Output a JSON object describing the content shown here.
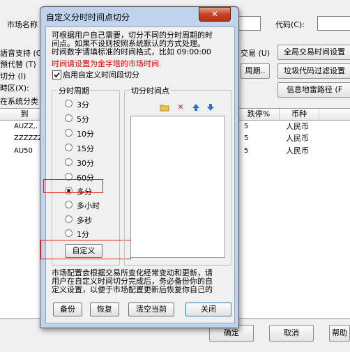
{
  "background": {
    "market_name_label": "市场名称",
    "code_label": "代码(C):",
    "left_labels": [
      "語音支持 (G",
      "預代替 (T)",
      "切分 (I)",
      "時区(X):",
      "在系统分类"
    ],
    "right_labels": [
      "交易 (U)"
    ],
    "right_buttons": [
      "全局交易时间设置",
      "垃圾代码过滤设置",
      "信息地雷路径 (F"
    ],
    "period_button": "周期..",
    "table": {
      "headers": [
        "到",
        "跌停%",
        "币种"
      ],
      "rows": [
        {
          "to": "AUZZ,.",
          "pct": "5",
          "currency": "人民币"
        },
        {
          "to": "ZZZZZZ",
          "pct": "5",
          "currency": "人民币"
        },
        {
          "to": "AU50",
          "pct": "5",
          "currency": "人民币"
        }
      ]
    },
    "bottom_buttons": {
      "ok": "确定",
      "cancel": "取消",
      "help": "帮助"
    }
  },
  "dialog": {
    "title": "自定义分时时间点切分",
    "close_symbol": "✕",
    "intro_line1": "可根据用户自己需要，切分不同的分时周期的时",
    "intro_line2": "间点。如果不设则按照系统默认的方式处理。",
    "intro_line3": "时间数字请填标准的时间格式，比如 09:00:00",
    "warning": "时间请设置为金字塔的市场时间.",
    "enable_checkbox_label": "启用自定义时间段切分",
    "enable_checked": true,
    "period_group_title": "分时周期",
    "periods": [
      "3分",
      "5分",
      "10分",
      "15分",
      "30分",
      "60分",
      "多分",
      "多小时",
      "多秒",
      "1分"
    ],
    "selected_period": "多分",
    "customize_button": "自定义",
    "cut_points_group_title": "切分时间点",
    "toolbar": {
      "folder": "folder-icon",
      "delete": "delete-icon",
      "up": "arrow-up-icon",
      "down": "arrow-down-icon"
    },
    "footer_line1": "市场配置会根据交易所变化经常变动和更新，请",
    "footer_line2": "用户在自定义时间切分完成后，务必备份你的自",
    "footer_line3": "定义设置，以便于市场配置更新后恢复你自己的",
    "buttons": {
      "backup": "备份",
      "restore": "恢复",
      "clear": "清空当前",
      "close": "关闭"
    }
  }
}
